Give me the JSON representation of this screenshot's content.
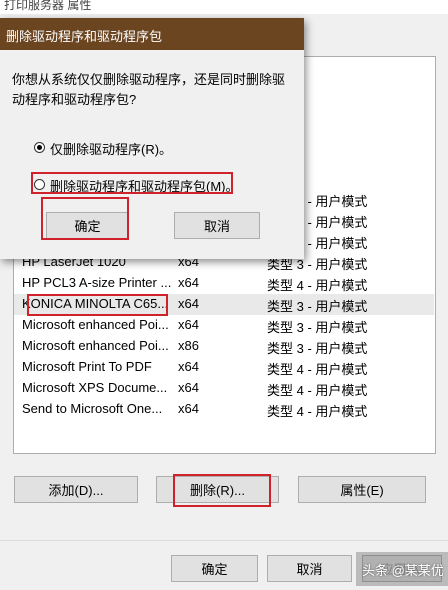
{
  "background_window": {
    "title": "打印服务器 属性",
    "drivers": [
      {
        "name": "",
        "env": "",
        "type": "类型 4 - 用户模式"
      },
      {
        "name": "",
        "env": "",
        "type": "类型 4 - 用户模式"
      },
      {
        "name": "",
        "env": "",
        "type": "类型 4 - 用户模式"
      },
      {
        "name": "HP LaserJet 1020",
        "env": "x64",
        "type": "类型 3 - 用户模式"
      },
      {
        "name": "HP PCL3 A-size Printer ...",
        "env": "x64",
        "type": "类型 4 - 用户模式"
      },
      {
        "name": "KONICA MINOLTA C65...",
        "env": "x64",
        "type": "类型 3 - 用户模式"
      },
      {
        "name": "Microsoft enhanced Poi...",
        "env": "x64",
        "type": "类型 3 - 用户模式"
      },
      {
        "name": "Microsoft enhanced Poi...",
        "env": "x86",
        "type": "类型 3 - 用户模式"
      },
      {
        "name": "Microsoft Print To PDF",
        "env": "x64",
        "type": "类型 4 - 用户模式"
      },
      {
        "name": "Microsoft XPS Docume...",
        "env": "x64",
        "type": "类型 4 - 用户模式"
      },
      {
        "name": "Send to Microsoft One...",
        "env": "x64",
        "type": "类型 4 - 用户模式"
      }
    ],
    "buttons": {
      "add": "添加(D)...",
      "remove": "删除(R)...",
      "properties": "属性(E)"
    },
    "footer": {
      "ok": "确定",
      "cancel": "取消",
      "apply": "应用(A)"
    }
  },
  "dialog": {
    "title": "删除驱动程序和驱动程序包",
    "message": "你想从系统仅仅删除驱动程序，还是同时删除驱动程序和驱动程序包?",
    "options": [
      {
        "label": "仅删除驱动程序(R)。",
        "checked": true
      },
      {
        "label": "删除驱动程序和驱动程序包(M)。",
        "checked": false
      }
    ],
    "ok": "确定",
    "cancel": "取消"
  },
  "watermark": "头条 @某某优",
  "colors": {
    "dialog_title_bg": "#6b4420",
    "highlight_red": "#d0222a",
    "selected_row": "#e9e9e9"
  }
}
